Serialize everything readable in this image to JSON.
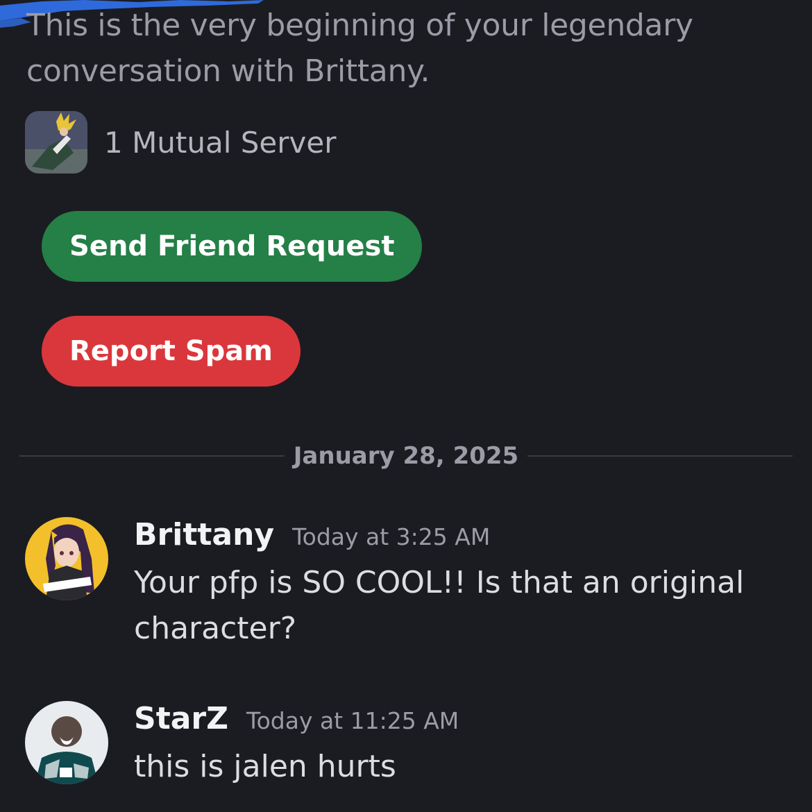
{
  "intro": {
    "text": "This is the very beginning of your legendary conversation with Brittany."
  },
  "mutual": {
    "label": "1 Mutual Server"
  },
  "actions": {
    "friend_request": "Send Friend Request",
    "report_spam": "Report Spam"
  },
  "divider": {
    "date": "January 28, 2025"
  },
  "messages": [
    {
      "username": "Brittany",
      "timestamp": "Today at 3:25 AM",
      "text": "Your pfp is SO COOL!! Is that an original character?"
    },
    {
      "username": "StarZ",
      "timestamp": "Today at 11:25 AM",
      "text": "this is jalen hurts"
    }
  ],
  "colors": {
    "background": "#1b1c21",
    "friend_button": "#248046",
    "spam_button": "#da373c",
    "muted_text": "#9c9ca6",
    "scribble": "#2f6fe6"
  }
}
